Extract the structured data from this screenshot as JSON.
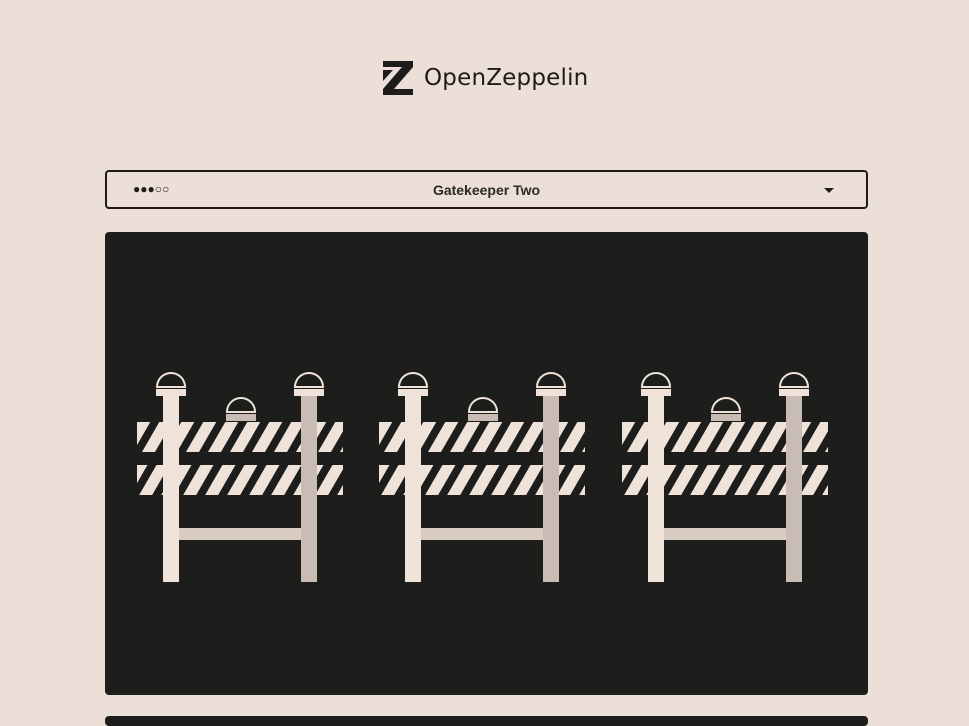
{
  "header": {
    "logo_text": "OpenZeppelin",
    "logo_icon": "openzeppelin-z-logo"
  },
  "level_select": {
    "difficulty": "●●●○○",
    "difficulty_level": 3,
    "difficulty_max": 5,
    "title": "Gatekeeper Two",
    "caret_icon": "caret-down-icon"
  },
  "hero": {
    "illustration": "three-road-barricades",
    "barricade_count": 3
  },
  "colors": {
    "background": "#ecdfd7",
    "dark": "#1d1d1b",
    "barricade_light": "#efe2d9",
    "barricade_shade": "#c8bcb4"
  }
}
